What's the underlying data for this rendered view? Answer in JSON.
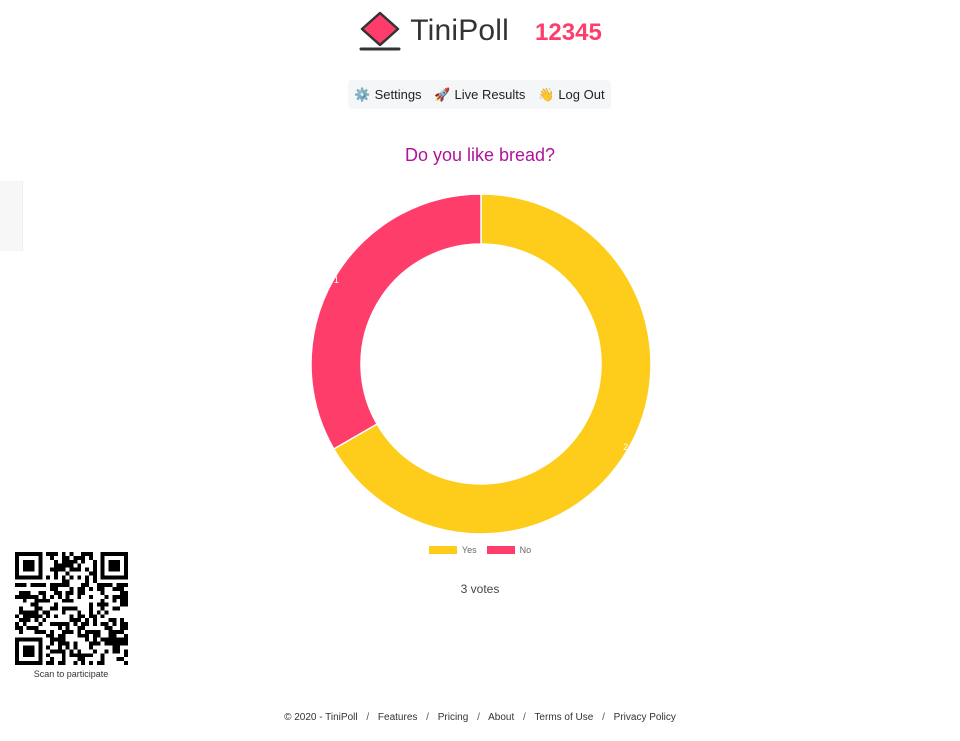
{
  "header": {
    "brand": "TiniPoll",
    "poll_code": "12345"
  },
  "nav": {
    "items": [
      {
        "icon": "⚙️",
        "label": "Settings"
      },
      {
        "icon": "🚀",
        "label": "Live Results"
      },
      {
        "icon": "👋",
        "label": "Log Out"
      }
    ]
  },
  "poll": {
    "question": "Do you like bread?",
    "votes_text": "3 votes"
  },
  "chart_data": {
    "type": "pie",
    "categories": [
      "Yes",
      "No"
    ],
    "values": [
      2,
      1
    ],
    "colors": [
      "#fecc1a",
      "#ff3d6b"
    ],
    "legend": "bottom"
  },
  "qr": {
    "caption": "Scan to participate"
  },
  "footer": {
    "copyright": "© 2020 - TiniPoll",
    "links": [
      "Features",
      "Pricing",
      "About",
      "Terms of Use",
      "Privacy Policy"
    ]
  }
}
